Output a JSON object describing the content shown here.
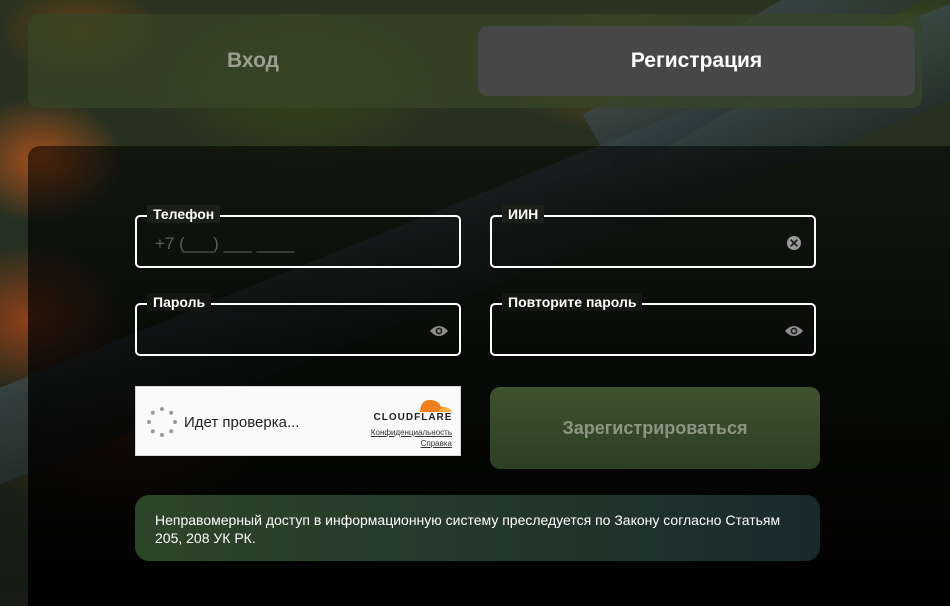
{
  "tabs": {
    "login_label": "Вход",
    "register_label": "Регистрация",
    "active": "register"
  },
  "form": {
    "phone": {
      "label": "Телефон",
      "placeholder": "+7 (___) ___ ____",
      "value": ""
    },
    "iin": {
      "label": "ИИН",
      "value": "",
      "icon": "clear-icon"
    },
    "password": {
      "label": "Пароль",
      "value": "",
      "icon": "eye-icon"
    },
    "password_repeat": {
      "label": "Повторите пароль",
      "value": "",
      "icon": "eye-icon"
    },
    "submit_label": "Зарегистрироваться"
  },
  "captcha": {
    "status_text": "Идет проверка...",
    "brand": "CLOUDFLARE",
    "privacy_link": "Конфиденциальность",
    "help_link": "Справка"
  },
  "notice": {
    "text": "Неправомерный доступ в информационную систему преследуется по Закону согласно Статьям 205, 208 УК РК."
  },
  "colors": {
    "active_tab_bg": "#474747",
    "submit_bg": "#3e5230",
    "cloudflare_orange": "#f38020"
  }
}
